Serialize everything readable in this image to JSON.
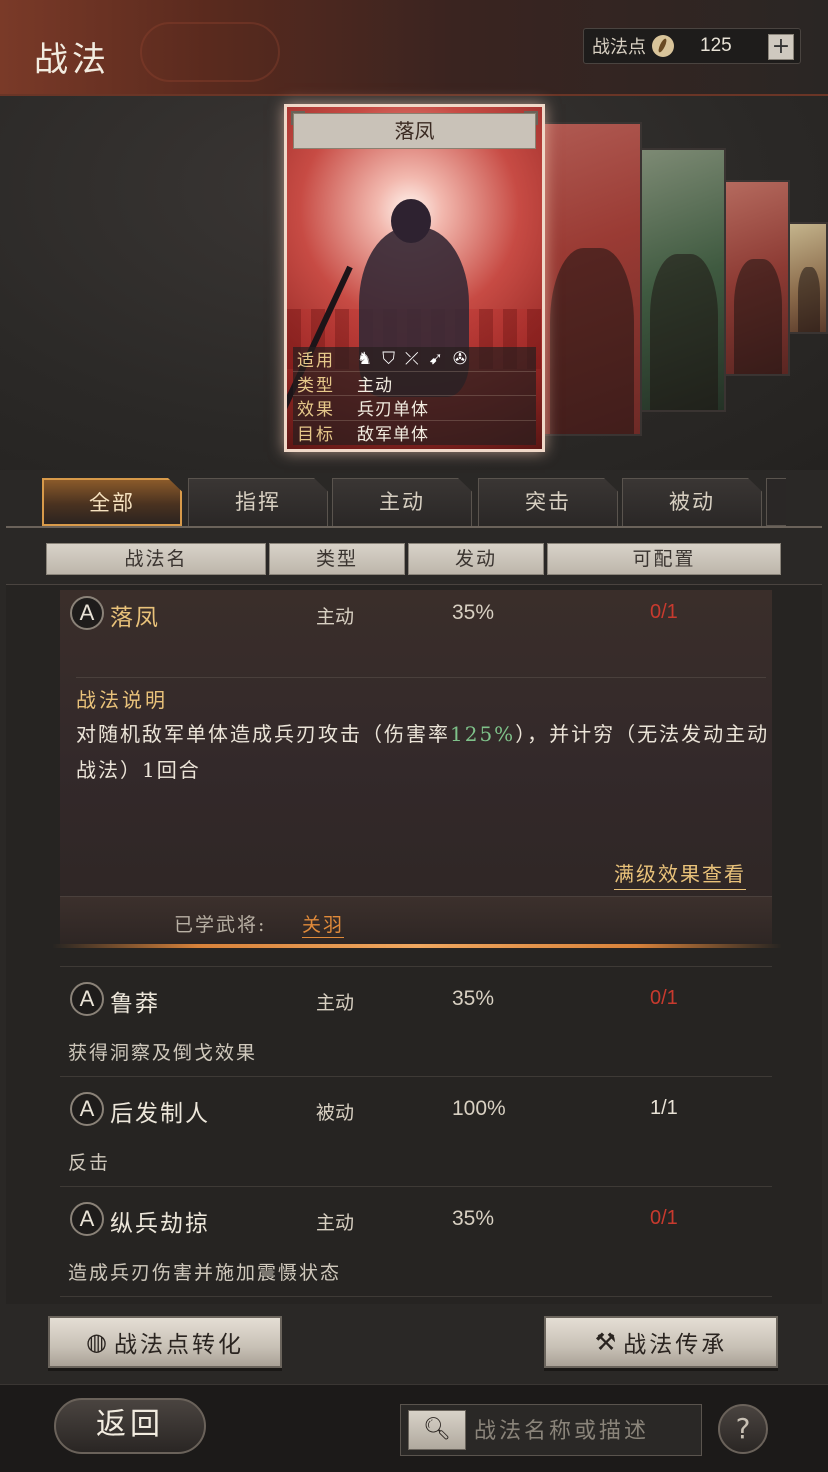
{
  "header": {
    "title": "战法",
    "points_label": "战法点",
    "points_value": "125",
    "plus_label": "+"
  },
  "card": {
    "name": "落凤",
    "rows": [
      {
        "key": "适用",
        "value": ""
      },
      {
        "key": "类型",
        "value": "主动"
      },
      {
        "key": "效果",
        "value": "兵刃单体"
      },
      {
        "key": "目标",
        "value": "敌军单体"
      }
    ],
    "troop_icons": [
      "cavalry-icon",
      "shield-icon",
      "bow-icon",
      "spear-icon",
      "chariot-icon"
    ]
  },
  "tabs": [
    {
      "label": "全部",
      "active": true
    },
    {
      "label": "指挥",
      "active": false
    },
    {
      "label": "主动",
      "active": false
    },
    {
      "label": "突击",
      "active": false
    },
    {
      "label": "被动",
      "active": false
    }
  ],
  "columns": [
    "战法名",
    "类型",
    "发动",
    "可配置"
  ],
  "skills": [
    {
      "badge": "A",
      "name": "落凤",
      "type": "主动",
      "rate": "35%",
      "config": "0/1",
      "expanded": true,
      "desc_title": "战法说明",
      "desc_part1": "对随机敌军单体造成兵刃攻击（伤害率",
      "desc_highlight": "125%",
      "desc_part2": "），并计穷（无法发动主动战法）1回合",
      "max_link": "满级效果查看",
      "learned_label": "已学武将:",
      "learned_name": "关羽"
    },
    {
      "badge": "A",
      "name": "鲁莽",
      "type": "主动",
      "rate": "35%",
      "config": "0/1",
      "desc": "获得洞察及倒戈效果"
    },
    {
      "badge": "A",
      "name": "后发制人",
      "type": "被动",
      "rate": "100%",
      "config": "1/1",
      "desc": "反击"
    },
    {
      "badge": "A",
      "name": "纵兵劫掠",
      "type": "主动",
      "rate": "35%",
      "config": "0/1",
      "desc": "造成兵刃伤害并施加震慑状态"
    }
  ],
  "buttons": {
    "convert_label": "战法点转化",
    "inherit_label": "战法传承"
  },
  "footer": {
    "back_label": "返回",
    "search_placeholder": "战法名称或描述",
    "help_label": "?"
  },
  "colors": {
    "gold": "#e9c27a",
    "red_config": "#c83a2e",
    "green_highlight": "#7fc28a",
    "active_tab_border": "#d89a4a"
  }
}
